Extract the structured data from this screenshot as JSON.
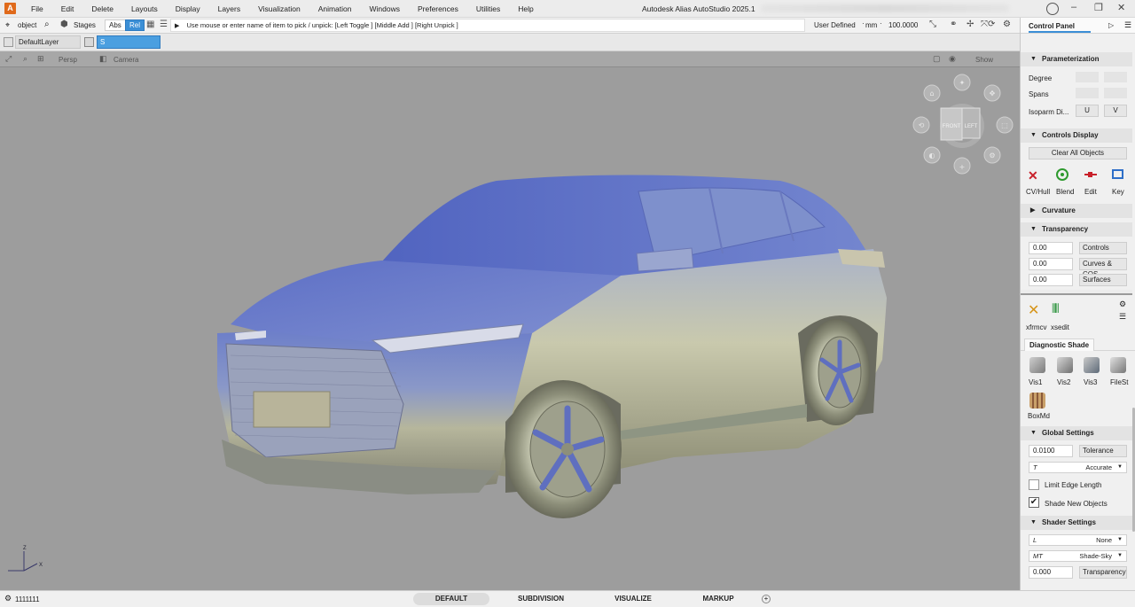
{
  "app": {
    "title": "Autodesk Alias AutoStudio 2025.1",
    "logo_letter": "A"
  },
  "menu": [
    "File",
    "Edit",
    "Delete",
    "Layouts",
    "Display",
    "Layers",
    "Visualization",
    "Animation",
    "Windows",
    "Preferences",
    "Utilities",
    "Help"
  ],
  "toolbar": {
    "pick_mode": "object",
    "stages": "Stages",
    "abs": "Abs",
    "rel": "Rel",
    "prompt": "Use mouse or enter name of item to pick / unpick: [Left Toggle ] [Middle Add ] [Right Unpick ]",
    "construction": "User Defined",
    "units": "mm",
    "scale": "100.0000"
  },
  "layers": {
    "default_layer": "DefaultLayer",
    "current_layer": "S"
  },
  "viewport": {
    "view_name": "Persp",
    "camera": "Camera",
    "show": "Show",
    "cube_front": "FRONT",
    "cube_left": "LEFT",
    "axis_x": "X",
    "axis_z": "Z"
  },
  "control_panel": {
    "title": "Control Panel",
    "parameterization": {
      "header": "Parameterization",
      "degree": "Degree",
      "spans": "Spans",
      "isoparm": "Isoparm Di...",
      "u": "U",
      "v": "V"
    },
    "controls_display": {
      "header": "Controls Display",
      "clear_all": "Clear All Objects",
      "items": [
        "CV/Hull",
        "Blend",
        "Edit",
        "Key"
      ]
    },
    "curvature": {
      "header": "Curvature"
    },
    "transparency": {
      "header": "Transparency",
      "rows": [
        {
          "value": "0.00",
          "label": "Controls"
        },
        {
          "value": "0.00",
          "label": "Curves & COS"
        },
        {
          "value": "0.00",
          "label": "Surfaces"
        }
      ]
    },
    "tools": [
      "xfrmcv",
      "xsedit"
    ],
    "diagnostic": {
      "header": "Diagnostic Shade",
      "items": [
        "Vis1",
        "Vis2",
        "Vis3",
        "FileSt",
        "BoxMd"
      ]
    },
    "global_settings": {
      "header": "Global Settings",
      "tolerance_value": "0.0100",
      "tolerance_label": "Tolerance",
      "t_label": "T",
      "t_value": "Accurate",
      "limit_edge": "Limit Edge Length",
      "shade_new": "Shade New Objects"
    },
    "shader_settings": {
      "header": "Shader Settings",
      "l_label": "L",
      "l_value": "None",
      "mt_label": "MT",
      "mt_value": "Shade-Sky",
      "trans_value": "0.000",
      "trans_label": "Transparency"
    }
  },
  "status": {
    "coords": "1111111",
    "tabs": [
      "DEFAULT",
      "SUBDIVISION",
      "VISUALIZE",
      "MARKUP"
    ],
    "add": "+"
  },
  "colors": {
    "accent": "#3b8fd6",
    "viewport_bg": "#9d9d9d",
    "logo": "#e06a1b"
  }
}
